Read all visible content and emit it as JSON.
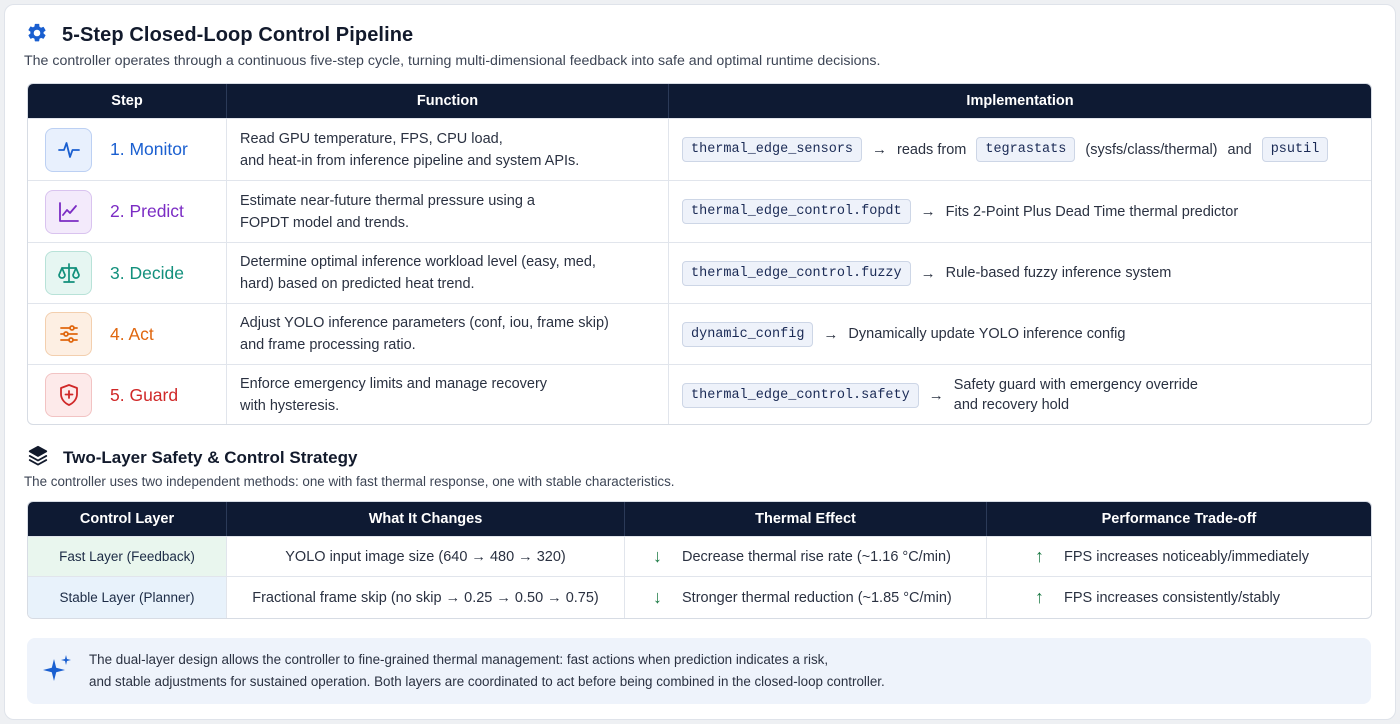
{
  "section1": {
    "title": "5-Step Closed-Loop Control Pipeline",
    "subtitle": "The controller operates through a continuous five-step cycle, turning multi-dimensional feedback into safe and optimal runtime decisions.",
    "headers": [
      "Step",
      "Function",
      "Implementation"
    ],
    "rows": [
      {
        "icon": "activity-icon",
        "step": "1. Monitor",
        "color": "#1a5fd0",
        "func1": "Read GPU temperature, FPS, CPU load,",
        "func2": "and heat-in from inference pipeline and system APIs.",
        "code1": "thermal_edge_sensors",
        "arrow": "→",
        "text1": "reads from",
        "code2": "tegrastats",
        "text2": "(sysfs/class/thermal)",
        "text3": "and",
        "code3": "psutil"
      },
      {
        "icon": "trend-chart-icon",
        "step": "2. Predict",
        "color": "#7b2cc4",
        "func1": "Estimate near-future thermal pressure using a",
        "func2": "FOPDT model and trends.",
        "code1": "thermal_edge_control.fopdt",
        "arrow": "→",
        "text1": "Fits 2-Point Plus Dead Time thermal predictor"
      },
      {
        "icon": "scale-icon",
        "step": "3. Decide",
        "color": "#12907c",
        "func1": "Determine optimal inference workload level (easy, med,",
        "func2": "hard) based on predicted heat trend.",
        "code1": "thermal_edge_control.fuzzy",
        "arrow": "→",
        "text1": "Rule-based fuzzy inference system"
      },
      {
        "icon": "sliders-icon",
        "step": "4. Act",
        "color": "#e0670f",
        "func1": "Adjust YOLO inference parameters (conf, iou, frame skip)",
        "func2": "and frame processing ratio.",
        "code1": "dynamic_config",
        "arrow": "→",
        "text1": "Dynamically update YOLO inference config"
      },
      {
        "icon": "shield-plus-icon",
        "step": "5. Guard",
        "color": "#d02828",
        "func1": "Enforce emergency limits and manage recovery",
        "func2": "with hysteresis.",
        "code1": "thermal_edge_control.safety",
        "arrow": "→",
        "text1": "Safety guard with emergency override",
        "text1b": "and recovery hold"
      }
    ]
  },
  "section2": {
    "title": "Two-Layer Safety & Control Strategy",
    "subtitle": "The controller uses two independent methods: one with fast thermal response, one with stable characteristics.",
    "headers": [
      "Control Layer",
      "What It Changes",
      "Thermal Effect",
      "Performance Trade-off"
    ],
    "rows": [
      {
        "layer": "Fast Layer (Feedback)",
        "changes": "YOLO input image size (640 → 480 → 320)",
        "thermal_arrow": "↓",
        "thermal": "Decrease thermal rise rate (~1.16 °C/min)",
        "perf_arrow": "↑",
        "perf": "FPS increases noticeably/immediately"
      },
      {
        "layer": "Stable Layer (Planner)",
        "changes": "Fractional frame skip (no skip → 0.25 → 0.50 → 0.75)",
        "thermal_arrow": "↓",
        "thermal": "Stronger thermal reduction (~1.85 °C/min)",
        "perf_arrow": "↑",
        "perf": "FPS increases consistently/stably"
      }
    ]
  },
  "note": {
    "icon": "sparkle-icon",
    "line1": "The dual-layer design allows the controller to fine-grained thermal management: fast actions when prediction indicates a risk,",
    "line2": "and stable adjustments for sustained operation. Both layers are coordinated to act before being combined in the closed-loop controller."
  }
}
